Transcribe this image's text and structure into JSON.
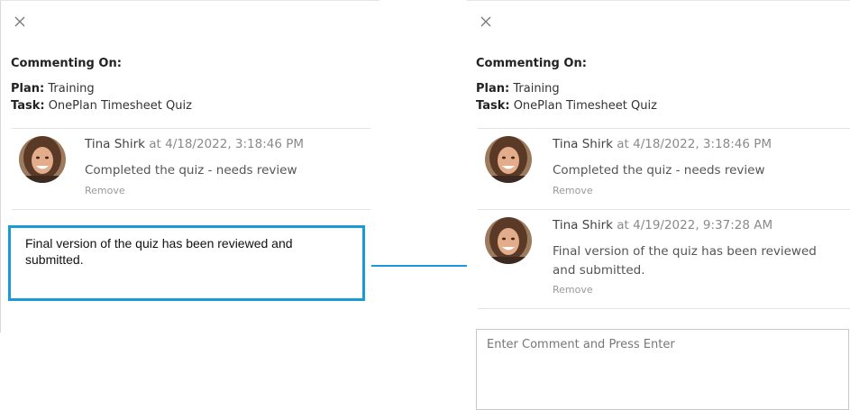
{
  "before": {
    "close_icon": "close-icon",
    "context": {
      "heading": "Commenting On:",
      "plan_label": "Plan:",
      "plan_value": "Training",
      "task_label": "Task:",
      "task_value": "OnePlan Timesheet Quiz"
    },
    "comments": [
      {
        "author": "Tina Shirk",
        "at": "at 4/18/2022, 3:18:46 PM",
        "text": "Completed the quiz - needs review",
        "remove": "Remove"
      }
    ],
    "compose_text": "Final version of the quiz has been reviewed and submitted."
  },
  "after": {
    "close_icon": "close-icon",
    "context": {
      "heading": "Commenting On:",
      "plan_label": "Plan:",
      "plan_value": "Training",
      "task_label": "Task:",
      "task_value": "OnePlan Timesheet Quiz"
    },
    "comments": [
      {
        "author": "Tina Shirk",
        "at": "at 4/18/2022, 3:18:46 PM",
        "text": "Completed the quiz - needs review",
        "remove": "Remove"
      },
      {
        "author": "Tina Shirk",
        "at": "at 4/19/2022, 9:37:28 AM",
        "text": "Final version of the quiz has been reviewed and submitted.",
        "remove": "Remove"
      }
    ],
    "input_placeholder": "Enter Comment and Press Enter"
  },
  "colors": {
    "highlight_border": "#1a9bd7",
    "arrow": "#1a9bd7"
  }
}
